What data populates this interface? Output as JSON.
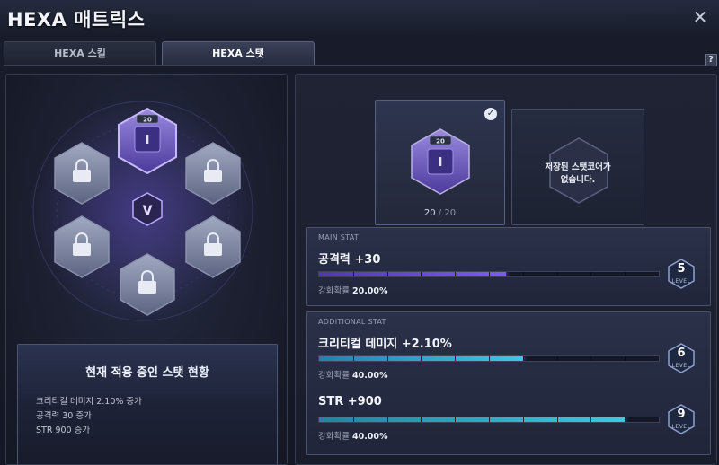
{
  "window": {
    "title": "HEXA 매트릭스",
    "close_glyph": "✕",
    "help_glyph": "?"
  },
  "tabs": [
    {
      "label": "HEXA 스킬",
      "active": false
    },
    {
      "label": "HEXA 스탯",
      "active": true
    }
  ],
  "board": {
    "core_level": "20",
    "center_emblem": "V",
    "slots": [
      "core-active",
      "locked",
      "locked",
      "locked",
      "locked",
      "locked"
    ]
  },
  "current_status": {
    "title": "현재 적용 중인 스탯 현황",
    "lines": [
      "크리티컬 데미지 2.10% 증가",
      "공격력 30 증가",
      "STR 900 증가"
    ]
  },
  "core_card": {
    "level_badge": "20",
    "count_current": "20",
    "count_sep": " / ",
    "count_max": "20"
  },
  "empty_card": {
    "line1": "저장된 스탯코어가",
    "line2": "없습니다."
  },
  "main_stat": {
    "section_label": "MAIN STAT",
    "name": "공격력 +30",
    "chance_label": "강화확률",
    "chance_value": "20.00%",
    "progress": 0.55,
    "level": "5",
    "level_label": "LEVEL",
    "color": "#7c5cf0"
  },
  "additional_stat": {
    "section_label": "ADDITIONAL STAT",
    "stats": [
      {
        "name": "크리티컬 데미지 +2.10%",
        "chance_label": "강화확률",
        "chance_value": "40.00%",
        "progress": 0.6,
        "level": "6",
        "level_label": "LEVEL"
      },
      {
        "name": "STR +900",
        "chance_label": "강화확률",
        "chance_value": "40.00%",
        "progress": 0.9,
        "level": "9",
        "level_label": "LEVEL"
      }
    ],
    "color": "#3cc8e8"
  }
}
